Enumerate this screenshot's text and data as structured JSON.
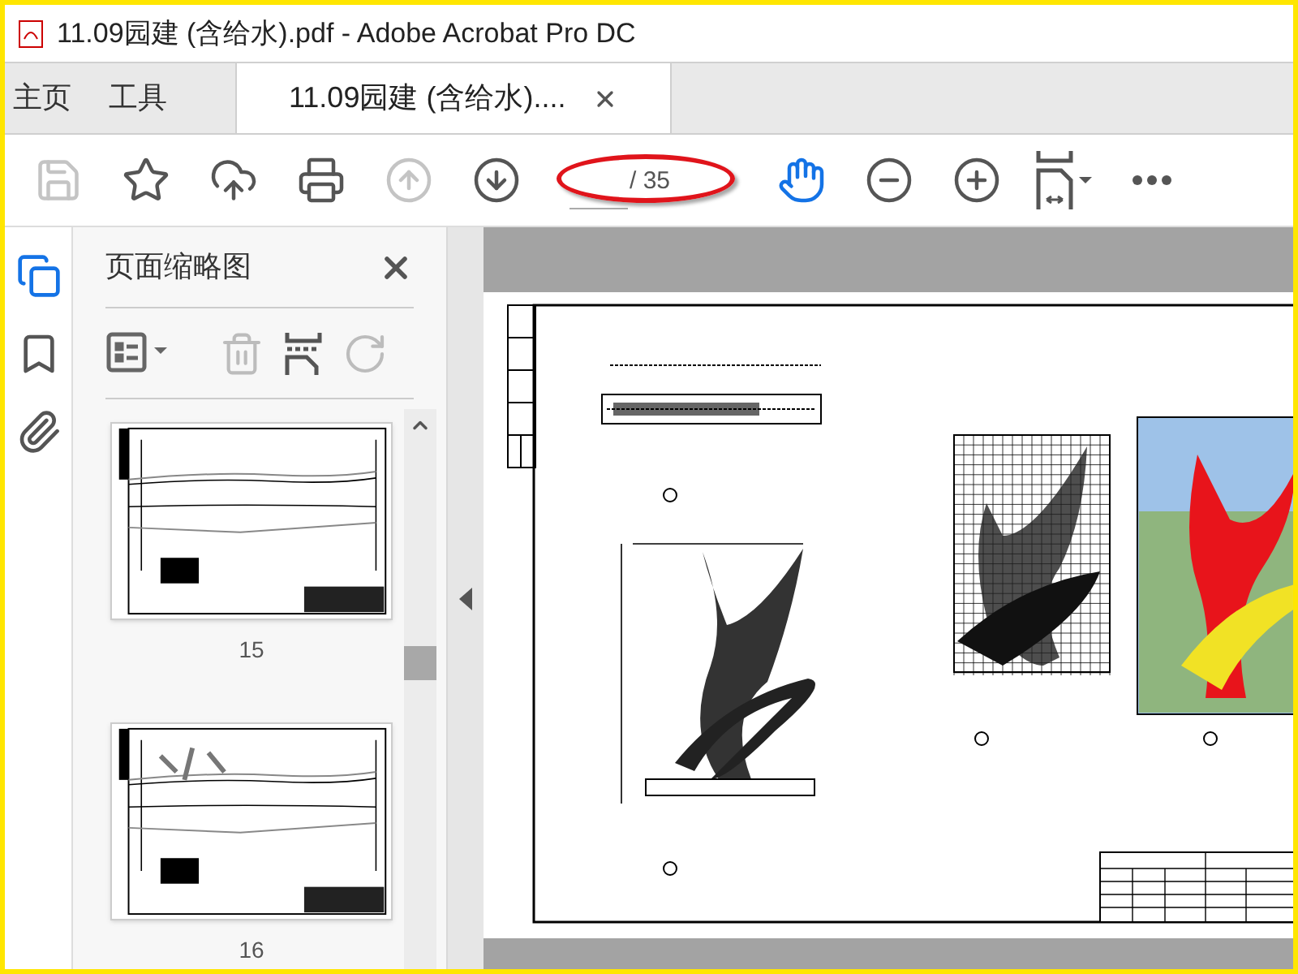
{
  "window": {
    "title": "11.09园建 (含给水).pdf - Adobe Acrobat Pro DC"
  },
  "tabs": [
    {
      "label": "主页",
      "selected": false,
      "closable": false
    },
    {
      "label": "工具",
      "selected": false,
      "closable": false
    },
    {
      "label": "11.09园建 (含给水)....",
      "selected": true,
      "closable": true
    }
  ],
  "toolbar": {
    "file_buttons": [
      {
        "disabled": true
      },
      {
        "disabled": false
      },
      {
        "disabled": false
      },
      {
        "disabled": false
      }
    ],
    "nav_buttons": [
      {
        "disabled": true
      },
      {
        "disabled": false
      }
    ],
    "page_field": {
      "total": "/ 35"
    },
    "view_buttons": [
      {
        "selected": true
      },
      {
        "selected": false
      },
      {
        "selected": false
      },
      {
        "selected": false
      },
      {
        "selected": false
      }
    ]
  },
  "side_rail": [
    {
      "selected": true
    },
    {
      "selected": false
    },
    {
      "selected": false
    }
  ],
  "thumbnail_panel": {
    "title": "页面缩略图",
    "tools": [
      {
        "disabled": false
      },
      {
        "disabled": true
      },
      {
        "disabled": false
      },
      {
        "disabled": true
      }
    ],
    "thumbnails": [
      {
        "label": "15"
      },
      {
        "label": "16"
      }
    ]
  }
}
